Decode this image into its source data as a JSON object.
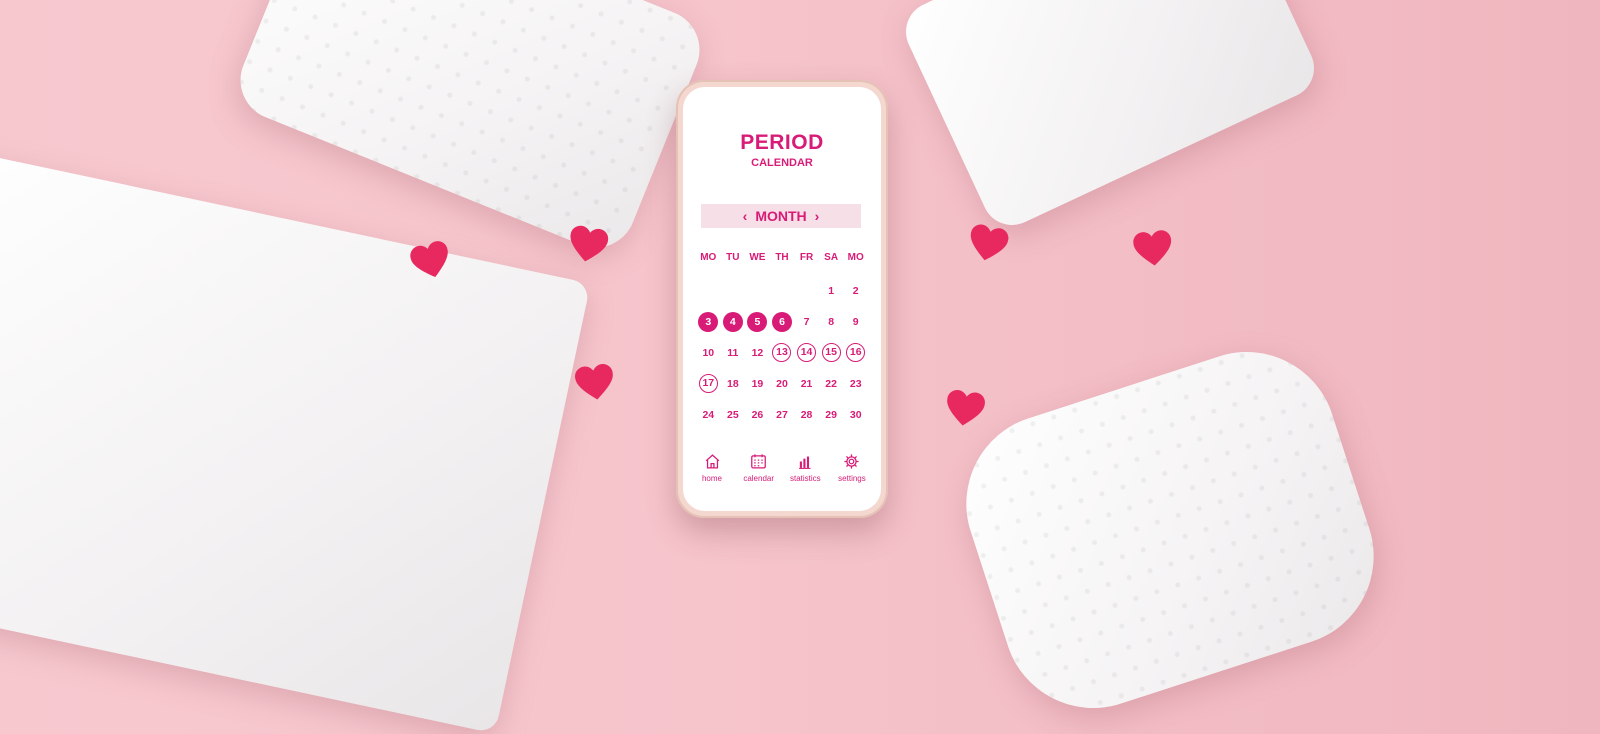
{
  "app": {
    "title": "PERIOD",
    "subtitle": "CALENDAR"
  },
  "month_bar": {
    "label": "MONTH",
    "prev_icon": "chevron-left-icon",
    "next_icon": "chevron-right-icon"
  },
  "weekdays": [
    "MO",
    "TU",
    "WE",
    "TH",
    "FR",
    "SA",
    "MO"
  ],
  "days": [
    {
      "label": ""
    },
    {
      "label": ""
    },
    {
      "label": ""
    },
    {
      "label": ""
    },
    {
      "label": ""
    },
    {
      "label": "1"
    },
    {
      "label": "2"
    },
    {
      "label": "3",
      "style": "filled"
    },
    {
      "label": "4",
      "style": "filled"
    },
    {
      "label": "5",
      "style": "filled"
    },
    {
      "label": "6",
      "style": "filled"
    },
    {
      "label": "7"
    },
    {
      "label": "8"
    },
    {
      "label": "9"
    },
    {
      "label": "10"
    },
    {
      "label": "11"
    },
    {
      "label": "12"
    },
    {
      "label": "13",
      "style": "ring"
    },
    {
      "label": "14",
      "style": "ring"
    },
    {
      "label": "15",
      "style": "ring"
    },
    {
      "label": "16",
      "style": "ring"
    },
    {
      "label": "17",
      "style": "ring"
    },
    {
      "label": "18"
    },
    {
      "label": "19"
    },
    {
      "label": "20"
    },
    {
      "label": "21"
    },
    {
      "label": "22"
    },
    {
      "label": "23"
    },
    {
      "label": "24"
    },
    {
      "label": "25"
    },
    {
      "label": "26"
    },
    {
      "label": "27"
    },
    {
      "label": "28"
    },
    {
      "label": "29"
    },
    {
      "label": "30"
    }
  ],
  "nav": [
    {
      "label": "home",
      "icon": "home-icon"
    },
    {
      "label": "calendar",
      "icon": "calendar-icon"
    },
    {
      "label": "statistics",
      "icon": "bar-chart-icon"
    },
    {
      "label": "settings",
      "icon": "gear-icon"
    }
  ],
  "colors": {
    "accent": "#d81b77",
    "background": "#f6c4cb",
    "heart": "#e8295f",
    "month_bar": "#f7dfe8"
  }
}
